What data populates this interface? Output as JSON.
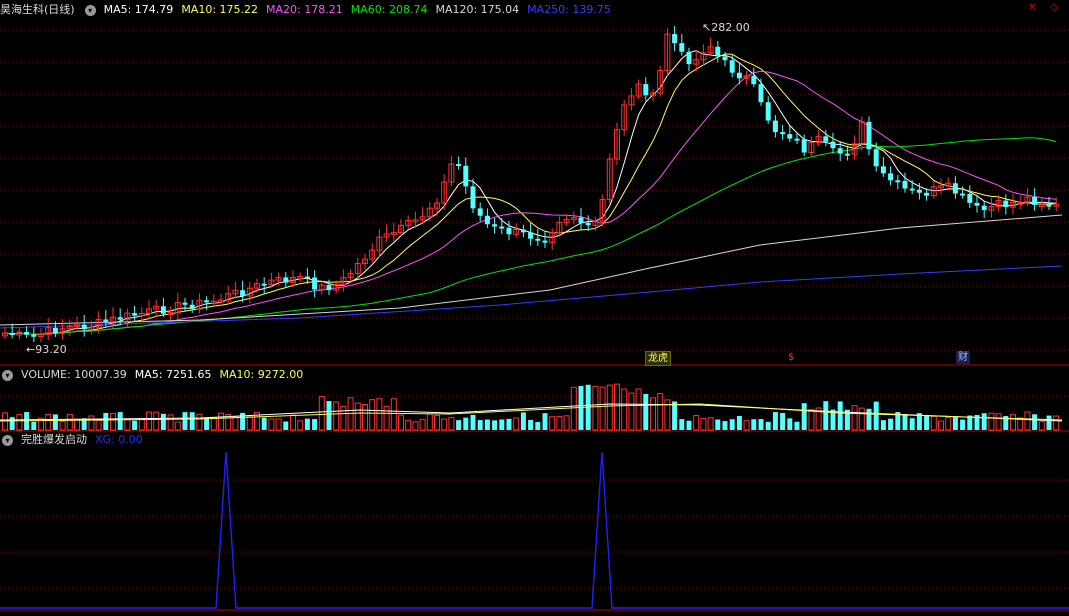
{
  "main_panel": {
    "title": "昊海生科(日线)",
    "toggle_icon": "circle-arrow-icon",
    "indicators": [
      {
        "label": "MA5: 174.79",
        "color": "#ffffff"
      },
      {
        "label": "MA10: 175.22",
        "color": "#ffff50"
      },
      {
        "label": "MA20: 178.21",
        "color": "#ff50ff"
      },
      {
        "label": "MA60: 208.74",
        "color": "#00e600"
      },
      {
        "label": "MA120: 175.04",
        "color": "#d8d8d8"
      },
      {
        "label": "MA250: 139.75",
        "color": "#3a3aff"
      }
    ],
    "high_marker": "282.00",
    "low_marker": "93.20",
    "event_badges": [
      "龙虎",
      "$",
      "财"
    ],
    "window_icons": [
      "close-icon",
      "diamond-icon"
    ]
  },
  "volume_panel": {
    "title": "VOLUME: 10007.39",
    "ma5": "MA5: 7251.65",
    "ma10": "MA10: 9272.00",
    "toggle_icon": "circle-arrow-icon"
  },
  "indicator_panel": {
    "title": "完胜爆发启动",
    "xg": "XG: 0.00",
    "toggle_icon": "circle-arrow-icon"
  },
  "colors": {
    "up": "#ff3030",
    "down": "#54ffff",
    "grid": "#8a0000",
    "xg_line": "#2020ff"
  },
  "chart_data": {
    "type": "candlestick",
    "price_range_visible": [
      93.2,
      282.0
    ],
    "ohlc_sample": [
      {
        "label": "low",
        "value": 93.2
      },
      {
        "label": "high",
        "value": 282.0
      }
    ],
    "moving_averages": {
      "MA5": 174.79,
      "MA10": 175.22,
      "MA20": 178.21,
      "MA60": 208.74,
      "MA120": 175.04,
      "MA250": 139.75
    },
    "volume": {
      "last": 10007.39,
      "MA5": 7251.65,
      "MA10": 9272.0
    },
    "xg_signal": {
      "last": 0.0,
      "spike_value": 1
    }
  }
}
